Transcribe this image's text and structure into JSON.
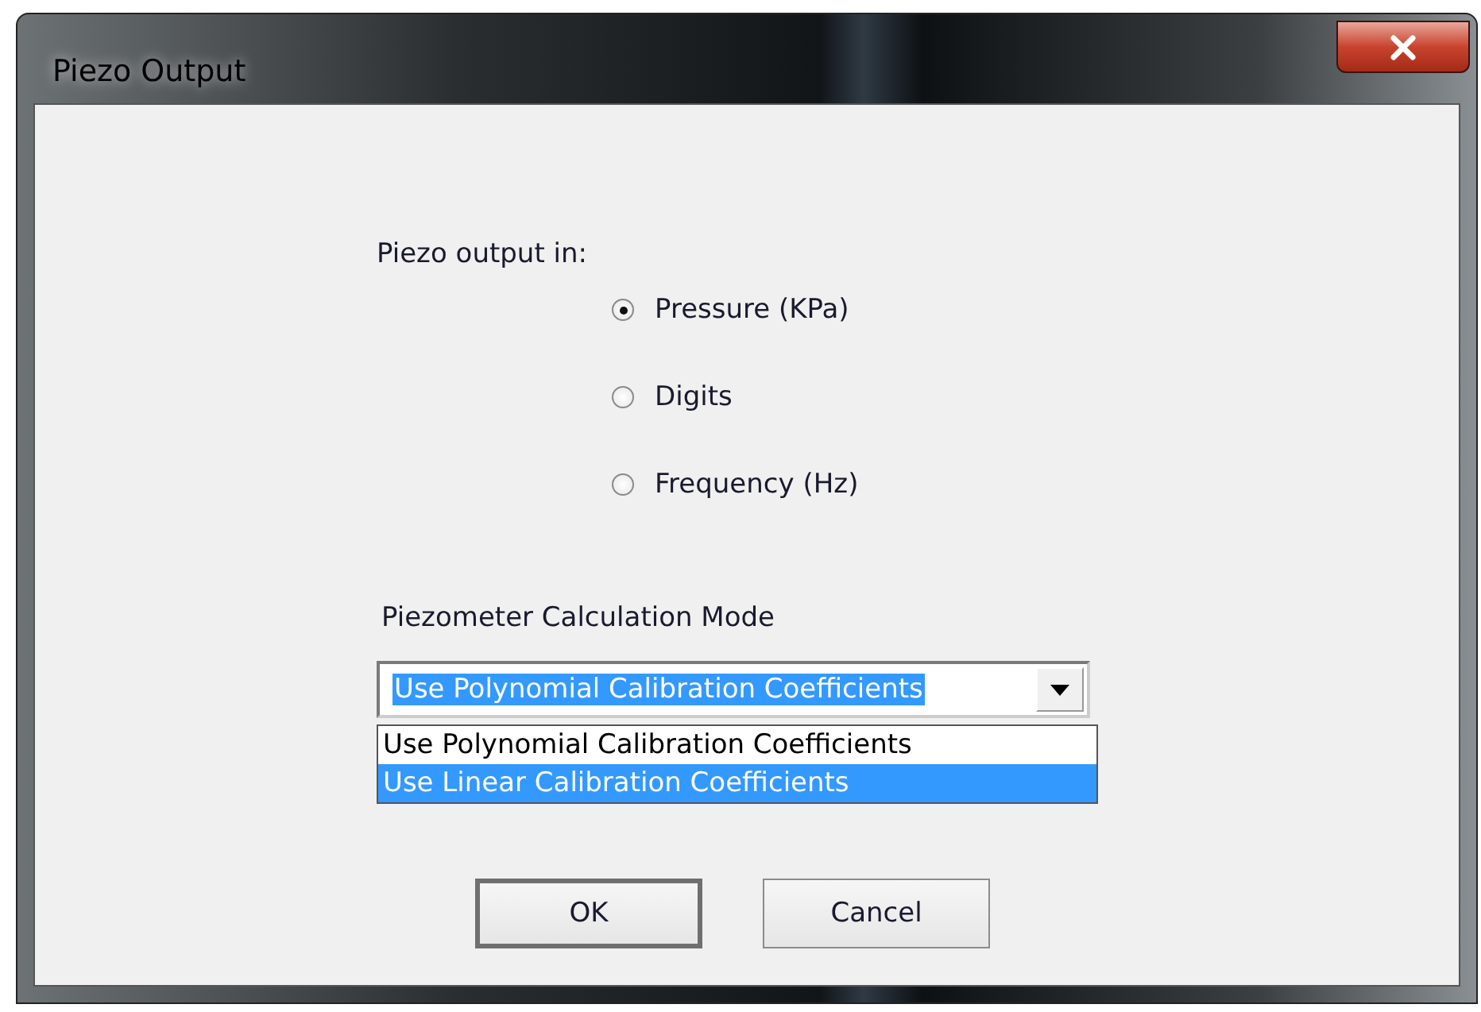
{
  "window": {
    "title": "Piezo Output"
  },
  "output_group": {
    "label": "Piezo output in:",
    "options": [
      {
        "label": "Pressure (KPa)",
        "selected": true
      },
      {
        "label": "Digits",
        "selected": false
      },
      {
        "label": "Frequency (Hz)",
        "selected": false
      }
    ]
  },
  "calculation_mode": {
    "label": "Piezometer Calculation Mode",
    "value": "Use Polynomial Calibration Coefficients",
    "expanded": true,
    "options": [
      {
        "label": "Use Polynomial Calibration Coefficients",
        "highlighted": false
      },
      {
        "label": "Use Linear Calibration Coefficients",
        "highlighted": true
      }
    ]
  },
  "buttons": [
    {
      "label": "OK",
      "default": true
    },
    {
      "label": "Cancel",
      "default": false
    }
  ]
}
